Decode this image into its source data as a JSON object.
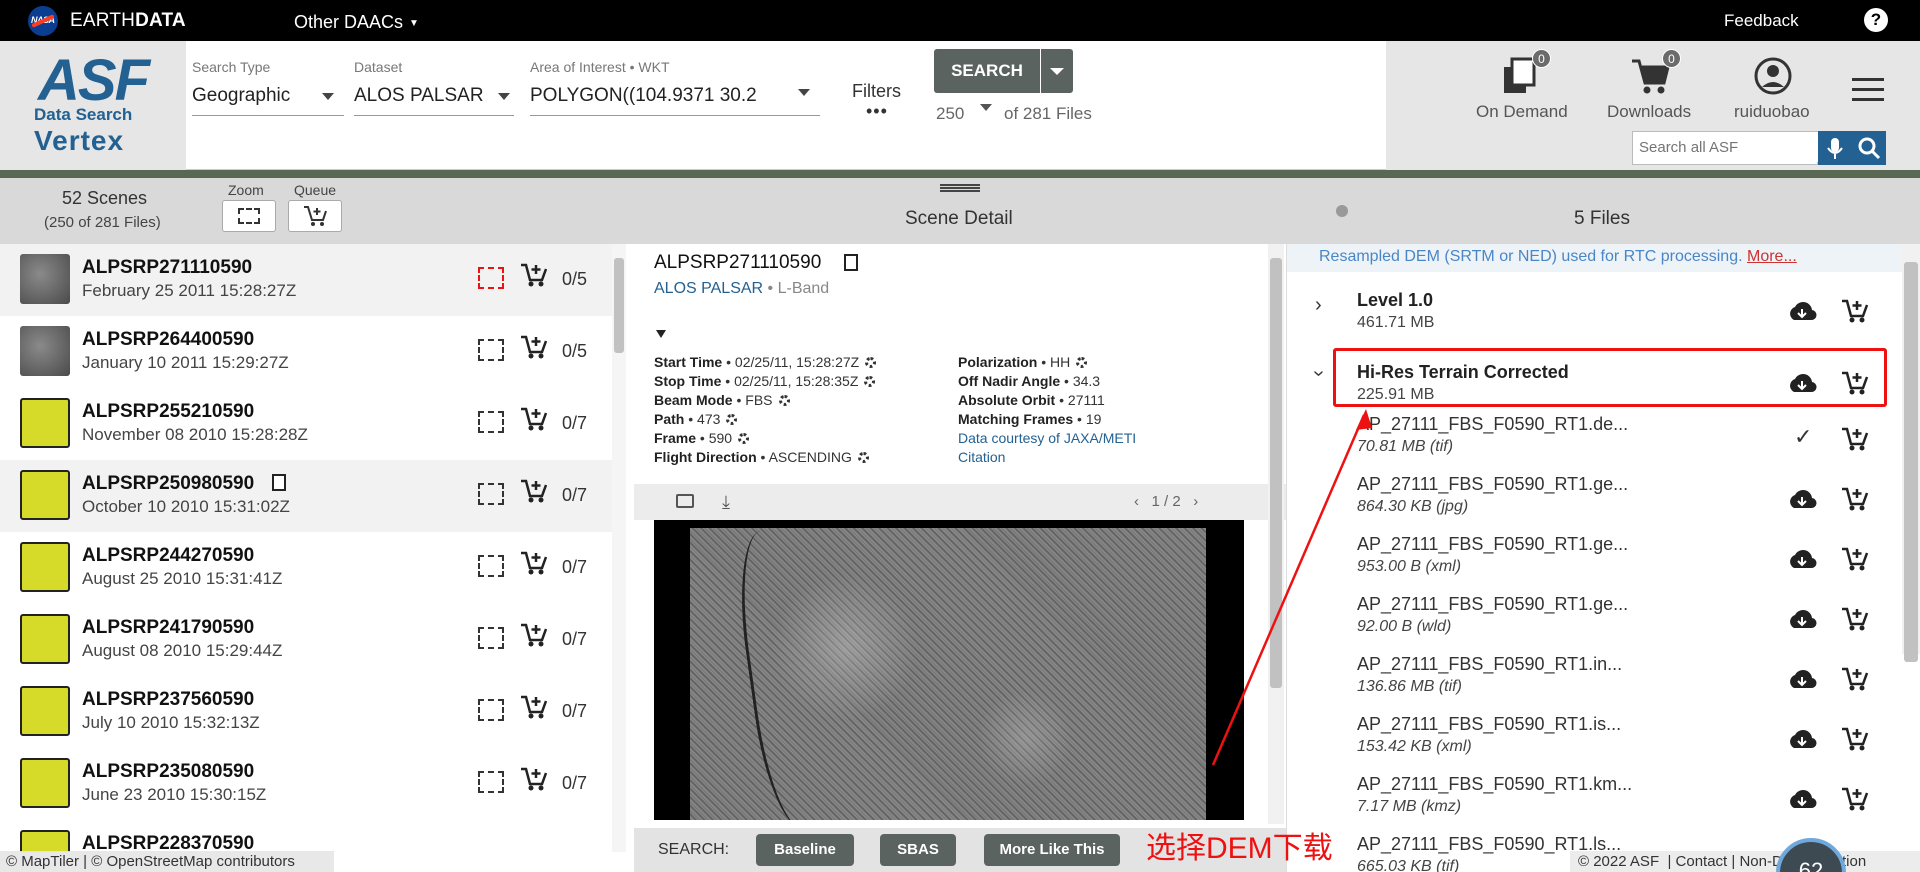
{
  "topbar": {
    "brand_prefix": "EARTH",
    "brand_suffix": "DATA",
    "other_daacs": "Other DAACs",
    "feedback": "Feedback"
  },
  "logo": {
    "asf": "ASF",
    "data_search": "Data Search",
    "vertex": "Vertex"
  },
  "search_form": {
    "search_type_label": "Search Type",
    "search_type_value": "Geographic",
    "dataset_label": "Dataset",
    "dataset_value": "ALOS PALSAR",
    "aoi_label": "Area of Interest • WKT",
    "aoi_value": "POLYGON((104.9371 30.2",
    "filters_label": "Filters",
    "search_button": "SEARCH",
    "max_results": "250",
    "of_files": "of 281 Files"
  },
  "header_actions": {
    "on_demand": {
      "label": "On Demand",
      "count": "0"
    },
    "downloads": {
      "label": "Downloads",
      "count": "0"
    },
    "user": {
      "label": "ruiduobao"
    },
    "search_all_placeholder": "Search all ASF"
  },
  "panel_headers": {
    "scenes_count": "52 Scenes",
    "scenes_sub": "(250 of 281 Files)",
    "zoom_label": "Zoom",
    "queue_label": "Queue",
    "scene_detail": "Scene Detail",
    "files_count": "5 Files"
  },
  "scenes": [
    {
      "name": "ALPSRP271110590",
      "date": "February 25 2011 15:28:27Z",
      "count": "0/5",
      "thumb": "gray"
    },
    {
      "name": "ALPSRP264400590",
      "date": "January 10 2011 15:29:27Z",
      "count": "0/5",
      "thumb": "gray"
    },
    {
      "name": "ALPSRP255210590",
      "date": "November 08 2010 15:28:28Z",
      "count": "0/7",
      "thumb": "yellow"
    },
    {
      "name": "ALPSRP250980590",
      "date": "October 10 2010 15:31:02Z",
      "count": "0/7",
      "thumb": "yellow"
    },
    {
      "name": "ALPSRP244270590",
      "date": "August 25 2010 15:31:41Z",
      "count": "0/7",
      "thumb": "yellow"
    },
    {
      "name": "ALPSRP241790590",
      "date": "August 08 2010 15:29:44Z",
      "count": "0/7",
      "thumb": "yellow"
    },
    {
      "name": "ALPSRP237560590",
      "date": "July 10 2010 15:32:13Z",
      "count": "0/7",
      "thumb": "yellow"
    },
    {
      "name": "ALPSRP235080590",
      "date": "June 23 2010 15:30:15Z",
      "count": "0/7",
      "thumb": "yellow"
    },
    {
      "name": "ALPSRP228370590",
      "date": "",
      "count": "",
      "thumb": "yellow"
    }
  ],
  "map_attribution": "© MapTiler | © OpenStreetMap contributors",
  "detail": {
    "title": "ALPSRP271110590",
    "dataset": "ALOS PALSAR",
    "band": "L-Band",
    "start_time_label": "Start Time",
    "start_time": "02/25/11, 15:28:27Z",
    "stop_time_label": "Stop Time",
    "stop_time": "02/25/11, 15:28:35Z",
    "beam_mode_label": "Beam Mode",
    "beam_mode": "FBS",
    "path_label": "Path",
    "path": "473",
    "frame_label": "Frame",
    "frame": "590",
    "flight_dir_label": "Flight Direction",
    "flight_dir": "ASCENDING",
    "polarization_label": "Polarization",
    "polarization": "HH",
    "off_nadir_label": "Off Nadir Angle",
    "off_nadir": "34.3",
    "abs_orbit_label": "Absolute Orbit",
    "abs_orbit": "27111",
    "matching_frames_label": "Matching Frames",
    "matching_frames": "19",
    "data_courtesy": "Data courtesy of JAXA/METI",
    "citation": "Citation",
    "pager": "1 / 2"
  },
  "search_bar": {
    "label": "SEARCH:",
    "baseline": "Baseline",
    "sbas": "SBAS",
    "more_like_this": "More Like This"
  },
  "files": {
    "note": "Resampled DEM (SRTM or NED) used for RTC processing.",
    "more": "More...",
    "groups": [
      {
        "name": "Level 1.0",
        "size": "461.71 MB"
      },
      {
        "name": "Hi-Res Terrain Corrected",
        "size": "225.91 MB"
      }
    ],
    "items": [
      {
        "name": "AP_27111_FBS_F0590_RT1.de...",
        "size": "70.81 MB (tif)",
        "queued": true
      },
      {
        "name": "AP_27111_FBS_F0590_RT1.ge...",
        "size": "864.30 KB (jpg)",
        "queued": false
      },
      {
        "name": "AP_27111_FBS_F0590_RT1.ge...",
        "size": "953.00 B (xml)",
        "queued": false
      },
      {
        "name": "AP_27111_FBS_F0590_RT1.ge...",
        "size": "92.00 B (wld)",
        "queued": false
      },
      {
        "name": "AP_27111_FBS_F0590_RT1.in...",
        "size": "136.86 MB (tif)",
        "queued": false
      },
      {
        "name": "AP_27111_FBS_F0590_RT1.is...",
        "size": "153.42 KB (xml)",
        "queued": false
      },
      {
        "name": "AP_27111_FBS_F0590_RT1.km...",
        "size": "7.17 MB (kmz)",
        "queued": false
      },
      {
        "name": "AP_27111_FBS_F0590_RT1.ls...",
        "size": "665.03 KB (tif)",
        "queued": false
      }
    ]
  },
  "footer": {
    "copyright": "© 2022 ASF",
    "contact": "Contact",
    "non_discrimination": "Non-Discrimination",
    "progress": "62"
  },
  "annotation": {
    "text": "选择DEM下载",
    "color": "#ee1111"
  },
  "colors": {
    "brand": "#236192",
    "button": "#5a6360",
    "highlight": "#ee1111"
  }
}
